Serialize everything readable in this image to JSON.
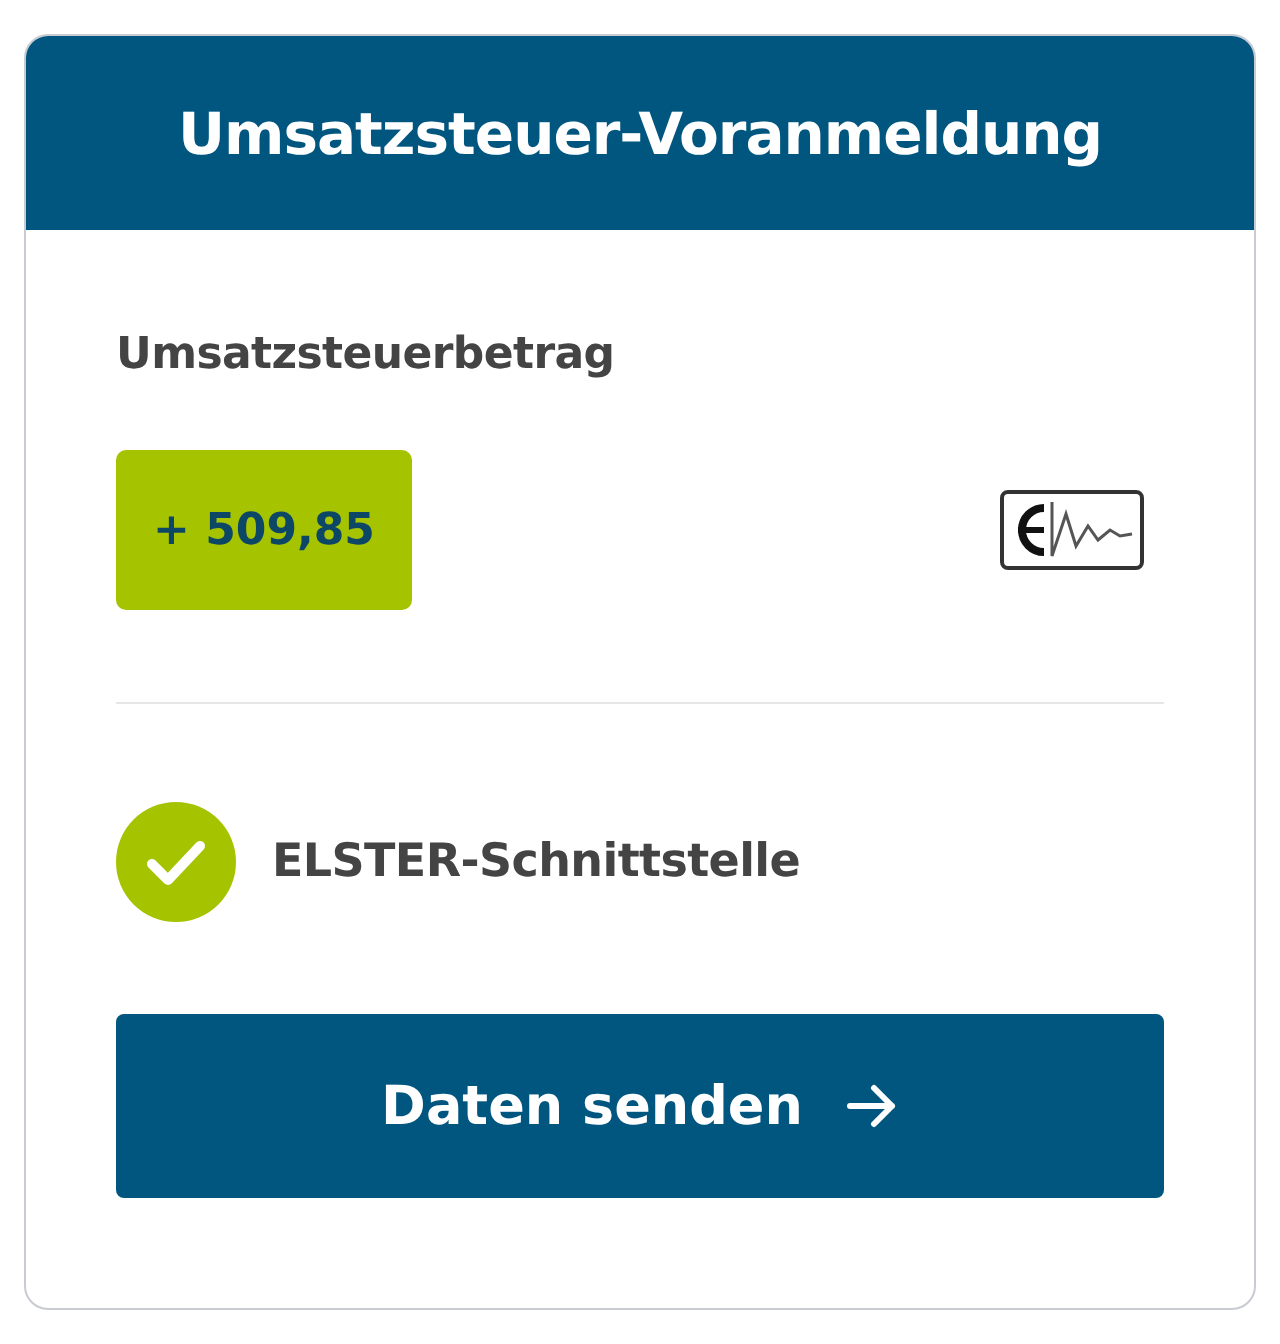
{
  "card": {
    "title": "Umsatzsteuer-Voranmeldung"
  },
  "amount": {
    "label": "Umsatzsteuerbetrag",
    "value": "+ 509,85"
  },
  "interface": {
    "label": "ELSTER-Schnittstelle",
    "connected": true
  },
  "submit_button": {
    "label": "Daten senden"
  }
}
